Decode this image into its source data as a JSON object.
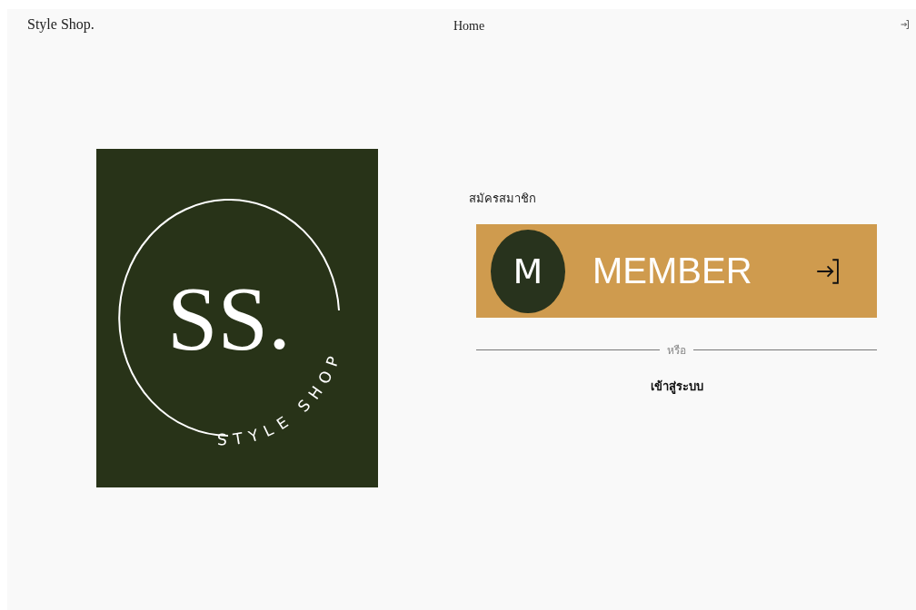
{
  "header": {
    "brand": "Style Shop.",
    "nav": [
      {
        "label": "Home"
      }
    ]
  },
  "logo": {
    "monogram": "SS.",
    "tagline": "STYLE SHOP"
  },
  "signup": {
    "title": "สมัครสมาชิก",
    "member_button": {
      "initial": "M",
      "label": "MEMBER"
    },
    "divider": "หรือ",
    "login_link": "เข้าสู่ระบบ"
  }
}
